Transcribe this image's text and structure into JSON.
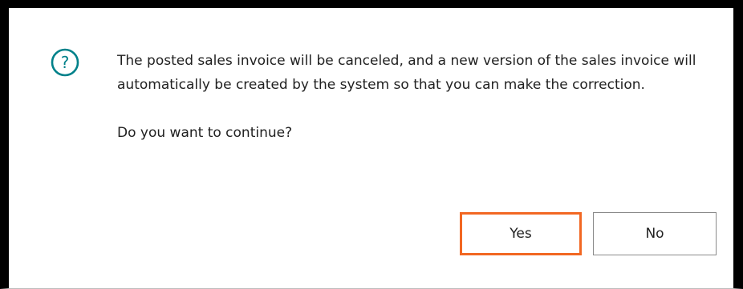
{
  "dialog": {
    "icon": "question-circle-icon",
    "accent_color": "#00818a",
    "message": "The posted sales invoice will be canceled, and a new version of the sales invoice will automatically be created by the system so that you can make the correction.",
    "question": "Do you want to continue?",
    "yes_label": "Yes",
    "no_label": "No",
    "highlight_color": "#f26722"
  }
}
